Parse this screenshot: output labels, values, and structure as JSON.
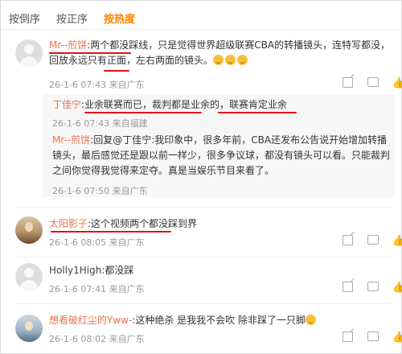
{
  "sort_tabs": [
    {
      "label": "按倒序"
    },
    {
      "label": "按正序"
    },
    {
      "label": "按热度"
    }
  ],
  "comments": [
    {
      "username": "Mr--煎饼",
      "text_pre": ":两个",
      "text_highlight": "都没踩线",
      "text_post": "，只是觉得世界超级联赛CBA的转播镜头，连特写都没，回放永远只有正面，左右两面的镜头。",
      "emoji": [
        "face-emoji",
        "face-emoji",
        "face-emoji"
      ],
      "time": "26-1-6 07:43 来自广东",
      "replies": [
        {
          "username": "丁佳宁",
          "text": ":业余联赛而已，裁判都是业余的，联赛肯定业余",
          "time": "26-1-6 07:43 来自福建"
        },
        {
          "username": "Mr--煎饼",
          "text": ":回复@丁佳宁:我印象中，很多年前，CBA还发布公告说开始增加转播镜头，最后感觉还是跟以前一样少，很多争议球，都没有镜头可以看。只能裁判之间你觉得我觉得来定夺。真是当娱乐节目来看了。",
          "time": "26-1-6 07:50 来自广东"
        }
      ]
    },
    {
      "username": "太阳影子",
      "text": ":这个视频两个都没踩到界",
      "time": "26-1-6 08:05 来自广东"
    },
    {
      "username": "Holly1High",
      "text": ":都没踩",
      "time": "26-1-6 07:41 来自广东"
    },
    {
      "username": "想看破红尘的Yww-",
      "text": ":这种绝杀 是我我不会吹 除非踩了一只脚",
      "time": "26-1-6 08:02 来自广东"
    }
  ],
  "colors": {
    "accent": "#ff8200",
    "username": "#eb7350",
    "highlight_underline": "#e2101a"
  }
}
